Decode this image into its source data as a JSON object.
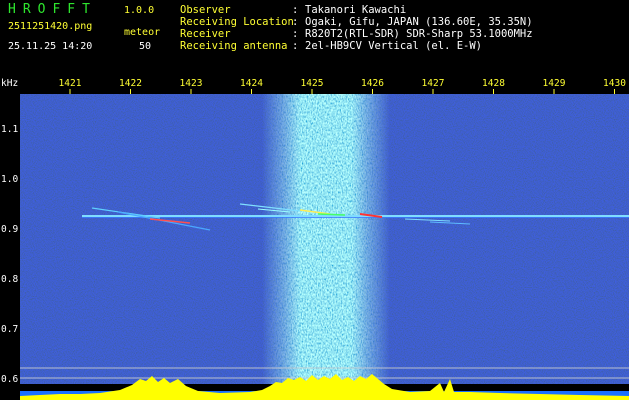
{
  "header": {
    "app_title": "HROFFT",
    "app_version": "1.0.0",
    "file_name": "2511251420.png",
    "meteor_label": "meteor",
    "datetime": "25.11.25 14:20",
    "meteor_count": "50",
    "info": [
      {
        "label": "Observer",
        "value": "Takanori Kawachi"
      },
      {
        "label": "Receiving Location",
        "value": "Ogaki, Gifu, JAPAN (136.60E, 35.35N)"
      },
      {
        "label": "Receiver",
        "value": "R820T2(RTL-SDR) SDR-Sharp 53.1000MHz"
      },
      {
        "label": "Receiving antenna",
        "value": "2el-HB9CV Vertical (el. E-W)"
      }
    ],
    "separator": ":"
  },
  "spectrogram": {
    "unit_label": "kHz",
    "x_ticks": [
      "1421",
      "1422",
      "1423",
      "1424",
      "1425",
      "1426",
      "1427",
      "1428",
      "1429",
      "1430"
    ],
    "y_ticks": [
      "1.1",
      "1.0",
      "0.9",
      "0.8",
      "0.7",
      "0.6"
    ],
    "colors": {
      "background": "#000000",
      "noise_base": "#0a1a7a",
      "noise_band": "#22b8e0",
      "carrier": "#7fdcff",
      "spectrum": "#ffff00",
      "axis_text": "#ffff33",
      "grid": "#d0d0d0"
    }
  }
}
